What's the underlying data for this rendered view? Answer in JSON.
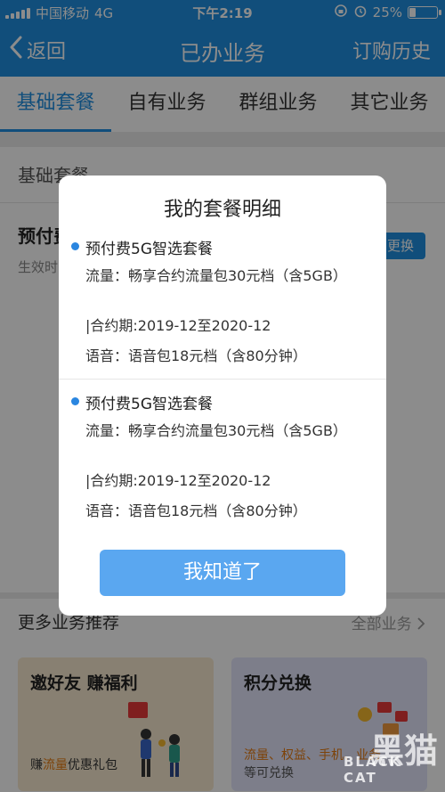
{
  "status_bar": {
    "carrier": "中国移动",
    "network": "4G",
    "time": "下午2:19",
    "battery": "25%",
    "battery_level": 0.25
  },
  "nav": {
    "back_label": "返回",
    "title": "已办业务",
    "history_label": "订购历史"
  },
  "tabs": [
    {
      "label": "基础套餐",
      "active": true
    },
    {
      "label": "自有业务",
      "active": false
    },
    {
      "label": "群组业务",
      "active": false
    },
    {
      "label": "其它业务",
      "active": false
    }
  ],
  "base_section": {
    "title": "基础套餐",
    "package_name": "预付费",
    "effective_label": "生效时",
    "change_button": "更换"
  },
  "more": {
    "title": "更多业务推荐",
    "all_label": "全部业务"
  },
  "cards": [
    {
      "title": "邀好友 赚福利",
      "sub_prefix": "赚",
      "sub_highlight": "流量",
      "sub_suffix": "优惠礼包"
    },
    {
      "title": "积分兑换",
      "sub_highlight": "流量、权益、手机、业务",
      "sub_suffix": "等可兑换"
    }
  ],
  "modal": {
    "title": "我的套餐明细",
    "plans": [
      {
        "name": "预付费5G智选套餐",
        "traffic": "流量：畅享合约流量包30元档（含5GB）",
        "contract": "|合约期:2019-12至2020-12",
        "voice": "语音：语音包18元档（含80分钟）"
      },
      {
        "name": "预付费5G智选套餐",
        "traffic": "流量：畅享合约流量包30元档（含5GB）",
        "contract": "|合约期:2019-12至2020-12",
        "voice": "语音：语音包18元档（含80分钟）"
      }
    ],
    "ok_button": "我知道了"
  },
  "watermark": {
    "logo": "黑猫",
    "text": "BLACK CAT"
  }
}
